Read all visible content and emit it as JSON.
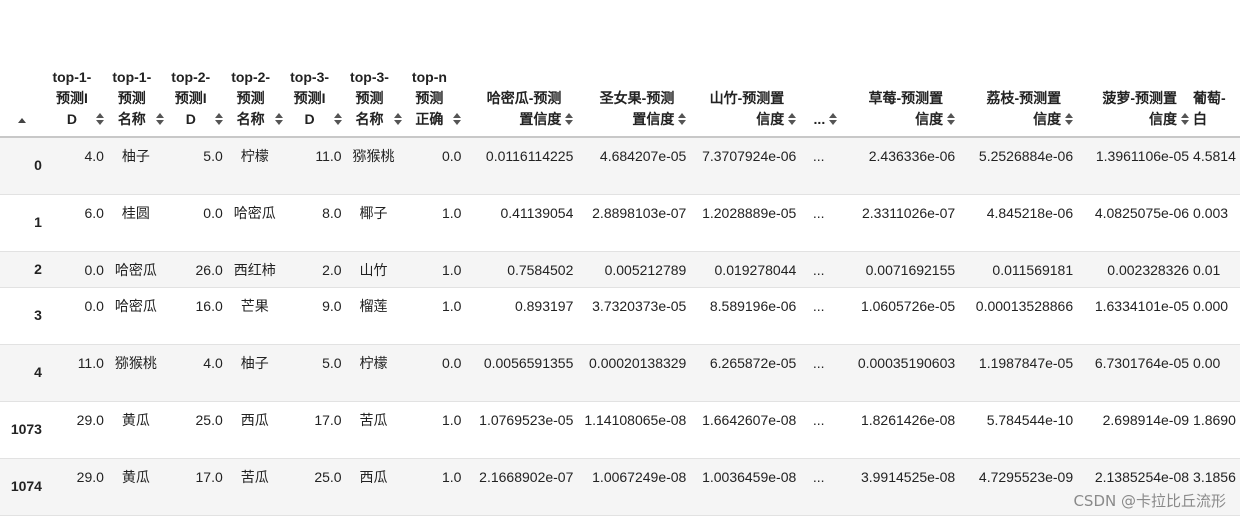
{
  "table": {
    "columns": [
      {
        "label": "top-1-预测ID"
      },
      {
        "label": "top-1-预测名称"
      },
      {
        "label": "top-2-预测ID"
      },
      {
        "label": "top-2-预测名称"
      },
      {
        "label": "top-3-预测ID"
      },
      {
        "label": "top-3-预测名称"
      },
      {
        "label": "top-n预测正确"
      },
      {
        "label": "哈密瓜-预测置信度"
      },
      {
        "label": "圣女果-预测置信度"
      },
      {
        "label": "山竹-预测置信度"
      },
      {
        "label": "..."
      },
      {
        "label": "草莓-预测置信度"
      },
      {
        "label": "荔枝-预测置信度"
      },
      {
        "label": "菠萝-预测置信度"
      },
      {
        "label": "葡萄-白"
      }
    ],
    "rows": [
      {
        "index": "0",
        "cells": [
          "4.0",
          "柚子",
          "5.0",
          "柠檬",
          "11.0",
          "猕猴桃",
          "0.0",
          "0.0116114225",
          "4.684207e-05",
          "7.3707924e-06",
          "...",
          "2.436336e-06",
          "5.2526884e-06",
          "1.3961106e-05",
          "4.5814"
        ]
      },
      {
        "index": "1",
        "cells": [
          "6.0",
          "桂圆",
          "0.0",
          "哈密瓜",
          "8.0",
          "椰子",
          "1.0",
          "0.41139054",
          "2.8898103e-07",
          "1.2028889e-05",
          "...",
          "2.3311026e-07",
          "4.845218e-06",
          "4.0825075e-06",
          "0.003"
        ]
      },
      {
        "index": "2",
        "cells": [
          "0.0",
          "哈密瓜",
          "26.0",
          "西红柿",
          "2.0",
          "山竹",
          "1.0",
          "0.7584502",
          "0.005212789",
          "0.019278044",
          "...",
          "0.0071692155",
          "0.011569181",
          "0.002328326",
          "0.01"
        ]
      },
      {
        "index": "3",
        "cells": [
          "0.0",
          "哈密瓜",
          "16.0",
          "芒果",
          "9.0",
          "榴莲",
          "1.0",
          "0.893197",
          "3.7320373e-05",
          "8.589196e-06",
          "...",
          "1.0605726e-05",
          "0.00013528866",
          "1.6334101e-05",
          "0.000"
        ]
      },
      {
        "index": "4",
        "cells": [
          "11.0",
          "猕猴桃",
          "4.0",
          "柚子",
          "5.0",
          "柠檬",
          "0.0",
          "0.0056591355",
          "0.00020138329",
          "6.265872e-05",
          "...",
          "0.00035190603",
          "1.1987847e-05",
          "6.7301764e-05",
          "0.00"
        ]
      },
      {
        "index": "1073",
        "cells": [
          "29.0",
          "黄瓜",
          "25.0",
          "西瓜",
          "17.0",
          "苦瓜",
          "1.0",
          "1.0769523e-05",
          "1.14108065e-08",
          "1.6642607e-08",
          "...",
          "1.8261426e-08",
          "5.784544e-10",
          "2.698914e-09",
          "1.8690"
        ]
      },
      {
        "index": "1074",
        "cells": [
          "29.0",
          "黄瓜",
          "17.0",
          "苦瓜",
          "25.0",
          "西瓜",
          "1.0",
          "2.1668902e-07",
          "1.0067249e-08",
          "1.0036459e-08",
          "...",
          "3.9914525e-08",
          "4.7295523e-09",
          "2.1385254e-08",
          "3.1856"
        ]
      }
    ]
  },
  "watermark": "CSDN @卡拉比丘流形"
}
